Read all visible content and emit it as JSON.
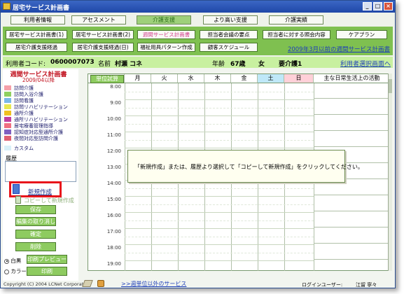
{
  "window": {
    "title": "居宅サービス計画書",
    "buttons": {
      "minimize": "_",
      "maximize": "□",
      "close": "×"
    }
  },
  "top_tabs": [
    {
      "label": "利用者情報",
      "active": false
    },
    {
      "label": "アセスメント",
      "active": false
    },
    {
      "label": "介護支援",
      "active": true
    },
    {
      "label": "より高い支援",
      "active": false
    },
    {
      "label": "介護実績",
      "active": false
    }
  ],
  "sub_buttons_row1": [
    {
      "label": "居宅サービス計画書(1)",
      "pink": false
    },
    {
      "label": "居宅サービス計画書(2)",
      "pink": false
    },
    {
      "label": "週間サービス計画書",
      "pink": true
    },
    {
      "label": "担当者会議の要点",
      "pink": false
    },
    {
      "label": "担当者に対する照会内容",
      "pink": false
    },
    {
      "label": "ケアプラン",
      "pink": false
    }
  ],
  "sub_buttons_row2": [
    {
      "label": "居宅介護支援経過",
      "pink": false
    },
    {
      "label": "居宅介護支援経過(日)",
      "pink": false
    },
    {
      "label": "福祉用具パターン作成",
      "pink": false
    },
    {
      "label": "顧客スケジュール",
      "pink": false
    }
  ],
  "history_link": "2009年3月以前の週間サービス計画書",
  "patient": {
    "code_label": "利用者コード:",
    "code": "0600007073",
    "name_label": "名前",
    "name": "村瀬 コネ",
    "age_label": "年齢",
    "age": "67歳",
    "gender": "女",
    "care_level": "要介護1",
    "select_link": "利用者選択画面へ"
  },
  "sidebar": {
    "title": "週間サービス計画書",
    "date": "2009/04以降",
    "legend": [
      {
        "label": "訪問介護",
        "color": "#f5a0a8"
      },
      {
        "label": "訪問入浴介護",
        "color": "#8fd060"
      },
      {
        "label": "訪問看護",
        "color": "#7ab8e8"
      },
      {
        "label": "訪問リハビリテーション",
        "color": "#e8e850"
      },
      {
        "label": "通所介護",
        "color": "#f0c020"
      },
      {
        "label": "通所リハビリテーション",
        "color": "#c040a0"
      },
      {
        "label": "居宅療養管理指導",
        "color": "#f07080"
      },
      {
        "label": "認知症対応型通所介護",
        "color": "#8060c0"
      },
      {
        "label": "夜間対応型訪問介護",
        "color": "#e06070"
      }
    ],
    "custom_label": "カスタム",
    "custom_color": "#d8f0f8",
    "history_label": "履歴",
    "new_button": "新規作成",
    "copy_button": "コピーして新規作成",
    "buttons": [
      "保存",
      "編集の取り消し",
      "確定",
      "削除"
    ],
    "print_preview": "印刷プレビュー",
    "print": "印刷",
    "radio_mono": "白黒",
    "radio_color": "カラー"
  },
  "schedule": {
    "unit_button": "単位試算",
    "days": [
      "月",
      "火",
      "水",
      "木",
      "金",
      "土",
      "日"
    ],
    "activity_header": "主な日常生活上の活動",
    "times": [
      "8:00",
      "9:00",
      "10:00",
      "11:00",
      "12:00",
      "13:00",
      "14:00",
      "15:00",
      "16:00",
      "17:00",
      "18:00",
      "19:00"
    ]
  },
  "message": "「新規作成」または、履歴より選択して「コピーして新規作成」をクリックしてください。",
  "footer": {
    "copyright": "Copyright (C) 2004 LCNet Corporation",
    "service_link": ">>週単位以外のサービス",
    "login_label": "ログインユーザー:",
    "user": "江留 寧々"
  },
  "colors": {
    "accent_green": "#7fc050",
    "patient_bar": "#c8f0a0",
    "highlight_red": "#e8151b",
    "link_blue": "#1e3fb8"
  }
}
